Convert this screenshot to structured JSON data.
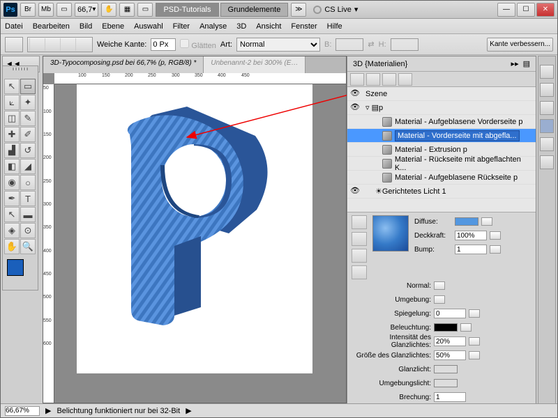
{
  "titlebar": {
    "zoom": "66,7",
    "tabs": [
      {
        "label": "PSD-Tutorials",
        "active": true
      },
      {
        "label": "Grundelemente",
        "active": false
      }
    ],
    "cs_live": "CS Live"
  },
  "menu": [
    "Datei",
    "Bearbeiten",
    "Bild",
    "Ebene",
    "Auswahl",
    "Filter",
    "Analyse",
    "3D",
    "Ansicht",
    "Fenster",
    "Hilfe"
  ],
  "options": {
    "weiche_kante_label": "Weiche Kante:",
    "weiche_kante": "0 Px",
    "glaetten": "Glätten",
    "art_label": "Art:",
    "art_value": "Normal",
    "b_label": "B:",
    "h_label": "H:",
    "kante_btn": "Kante verbessern..."
  },
  "documents": [
    {
      "label": "3D-Typocomposing.psd bei 66,7% (p, RGB/8) *",
      "active": true
    },
    {
      "label": "Unbenannt-2 bei 300% (E…",
      "active": false
    }
  ],
  "ruler_h": [
    "100",
    "150",
    "200",
    "250",
    "300",
    "350",
    "400",
    "450"
  ],
  "ruler_v": [
    "50",
    "100",
    "150",
    "200",
    "250",
    "300",
    "350",
    "400",
    "450",
    "500",
    "550",
    "600"
  ],
  "panel": {
    "title": "3D {Materialien}",
    "szene": "Szene",
    "root": "p",
    "materials": [
      "Material - Aufgeblasene Vorderseite p",
      "Material - Vorderseite mit abgefla...",
      "Material - Extrusion p",
      "Material - Rückseite mit abgeflachten K...",
      "Material - Aufgeblasene Rückseite p"
    ],
    "light": "Gerichtetes Licht 1"
  },
  "props": {
    "diffuse": "Diffuse:",
    "deckkraft_lbl": "Deckkraft:",
    "deckkraft": "100%",
    "bump_lbl": "Bump:",
    "bump": "1",
    "normal": "Normal:",
    "umgebung": "Umgebung:",
    "spiegelung_lbl": "Spiegelung:",
    "spiegelung": "0",
    "beleuchtung": "Beleuchtung:",
    "intens_lbl": "Intensität des Glanzlichtes:",
    "intens": "20%",
    "groesse_lbl": "Größe des Glanzlichtes:",
    "groesse": "50%",
    "glanzlicht": "Glanzlicht:",
    "umg_licht": "Umgebungslicht:",
    "brechung_lbl": "Brechung:",
    "brechung": "1"
  },
  "status": {
    "zoom": "66,67%",
    "msg": "Belichtung funktioniert nur bei 32-Bit"
  }
}
